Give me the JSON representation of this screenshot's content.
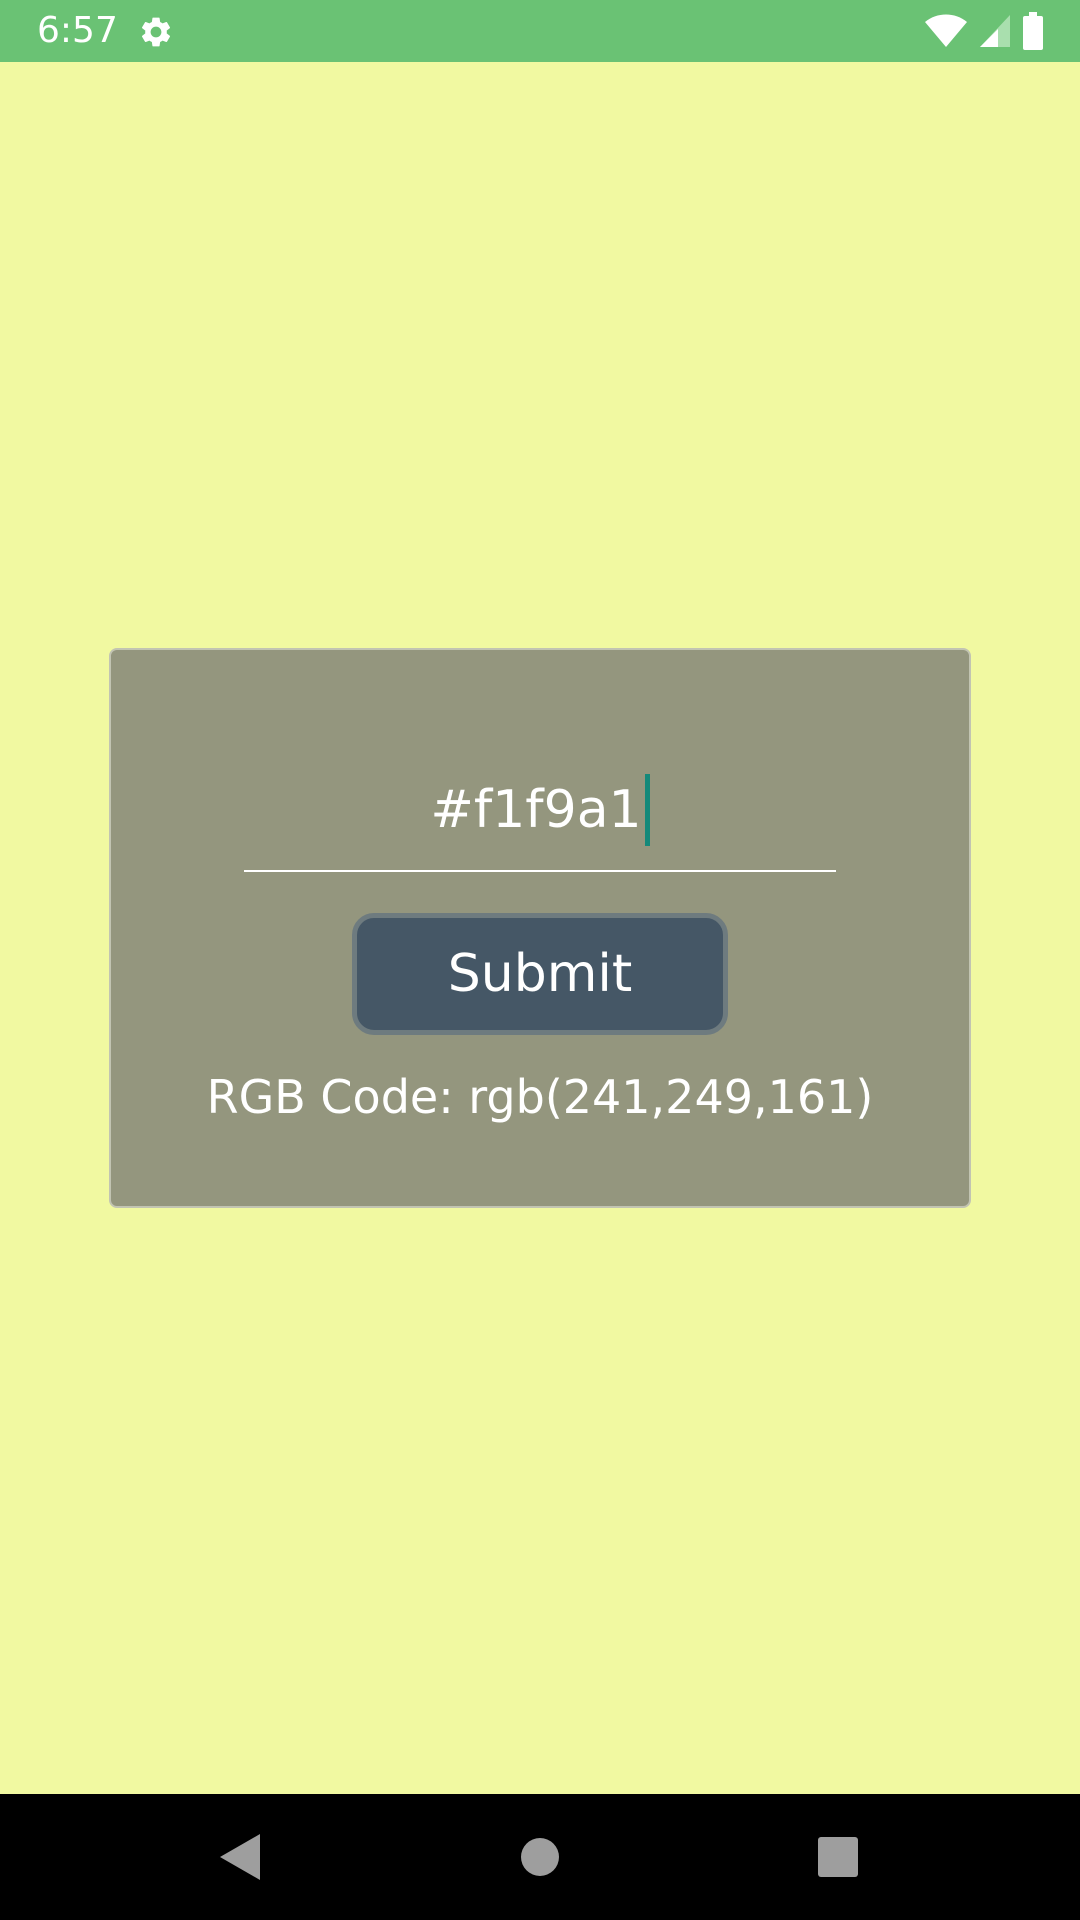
{
  "status_bar": {
    "time": "6:57",
    "background_color": "#6ac274",
    "icons": [
      "settings-gear-icon",
      "wifi-icon",
      "cellular-signal-icon",
      "battery-icon"
    ]
  },
  "app": {
    "background_color": "#f1f9a1",
    "card": {
      "background_color": "#94967e",
      "hex_input": {
        "value": "#f1f9a1",
        "caret_color": "#14897a"
      },
      "submit_button": {
        "label": "Submit",
        "background_color": "#455766"
      },
      "result_text": "RGB Code: rgb(241,249,161)"
    }
  },
  "nav_bar": {
    "background_color": "#000000",
    "buttons": [
      "back-icon",
      "home-icon",
      "recents-icon"
    ]
  }
}
